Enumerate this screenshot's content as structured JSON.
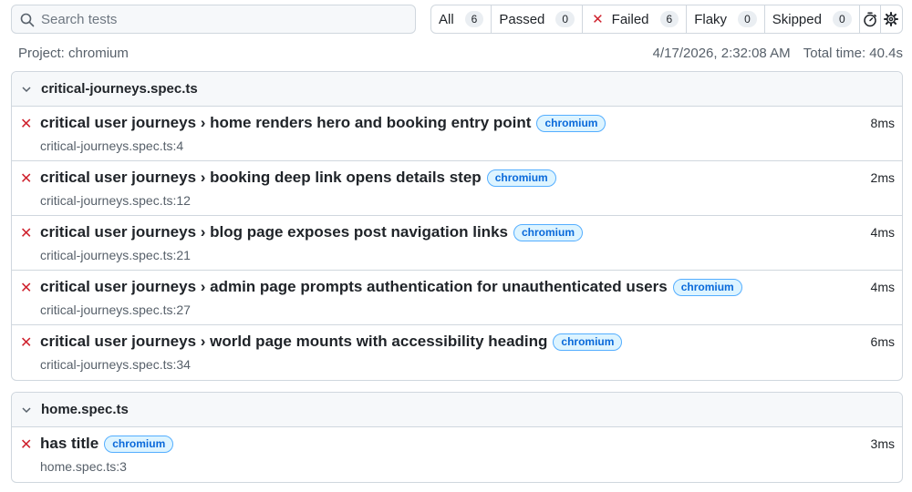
{
  "search": {
    "placeholder": "Search tests",
    "value": ""
  },
  "filters": [
    {
      "label": "All",
      "count": "6"
    },
    {
      "label": "Passed",
      "count": "0"
    },
    {
      "label": "Failed",
      "count": "6"
    },
    {
      "label": "Flaky",
      "count": "0"
    },
    {
      "label": "Skipped",
      "count": "0"
    }
  ],
  "meta": {
    "project": "Project: chromium",
    "timestamp": "4/17/2026, 2:32:08 AM",
    "total_time": "Total time: 40.4s"
  },
  "files": [
    {
      "name": "critical-journeys.spec.ts",
      "tests": [
        {
          "title": "critical user journeys › home renders hero and booking entry point",
          "project": "chromium",
          "location": "critical-journeys.spec.ts:4",
          "duration": "8ms"
        },
        {
          "title": "critical user journeys › booking deep link opens details step",
          "project": "chromium",
          "location": "critical-journeys.spec.ts:12",
          "duration": "2ms"
        },
        {
          "title": "critical user journeys › blog page exposes post navigation links",
          "project": "chromium",
          "location": "critical-journeys.spec.ts:21",
          "duration": "4ms"
        },
        {
          "title": "critical user journeys › admin page prompts authentication for unauthenticated users",
          "project": "chromium",
          "location": "critical-journeys.spec.ts:27",
          "duration": "4ms"
        },
        {
          "title": "critical user journeys › world page mounts with accessibility heading",
          "project": "chromium",
          "location": "critical-journeys.spec.ts:34",
          "duration": "6ms"
        }
      ]
    },
    {
      "name": "home.spec.ts",
      "tests": [
        {
          "title": "has title",
          "project": "chromium",
          "location": "home.spec.ts:3",
          "duration": "3ms"
        }
      ]
    }
  ],
  "icons": {
    "search": "search-icon",
    "failed": "x-icon",
    "timer": "stopwatch-icon",
    "settings": "gear-icon",
    "chevron": "chevron-down-icon"
  },
  "colors": {
    "failed": "#cf222e",
    "badge_text": "#0969da",
    "badge_bg": "#ddf4ff",
    "border": "#d0d7de"
  }
}
